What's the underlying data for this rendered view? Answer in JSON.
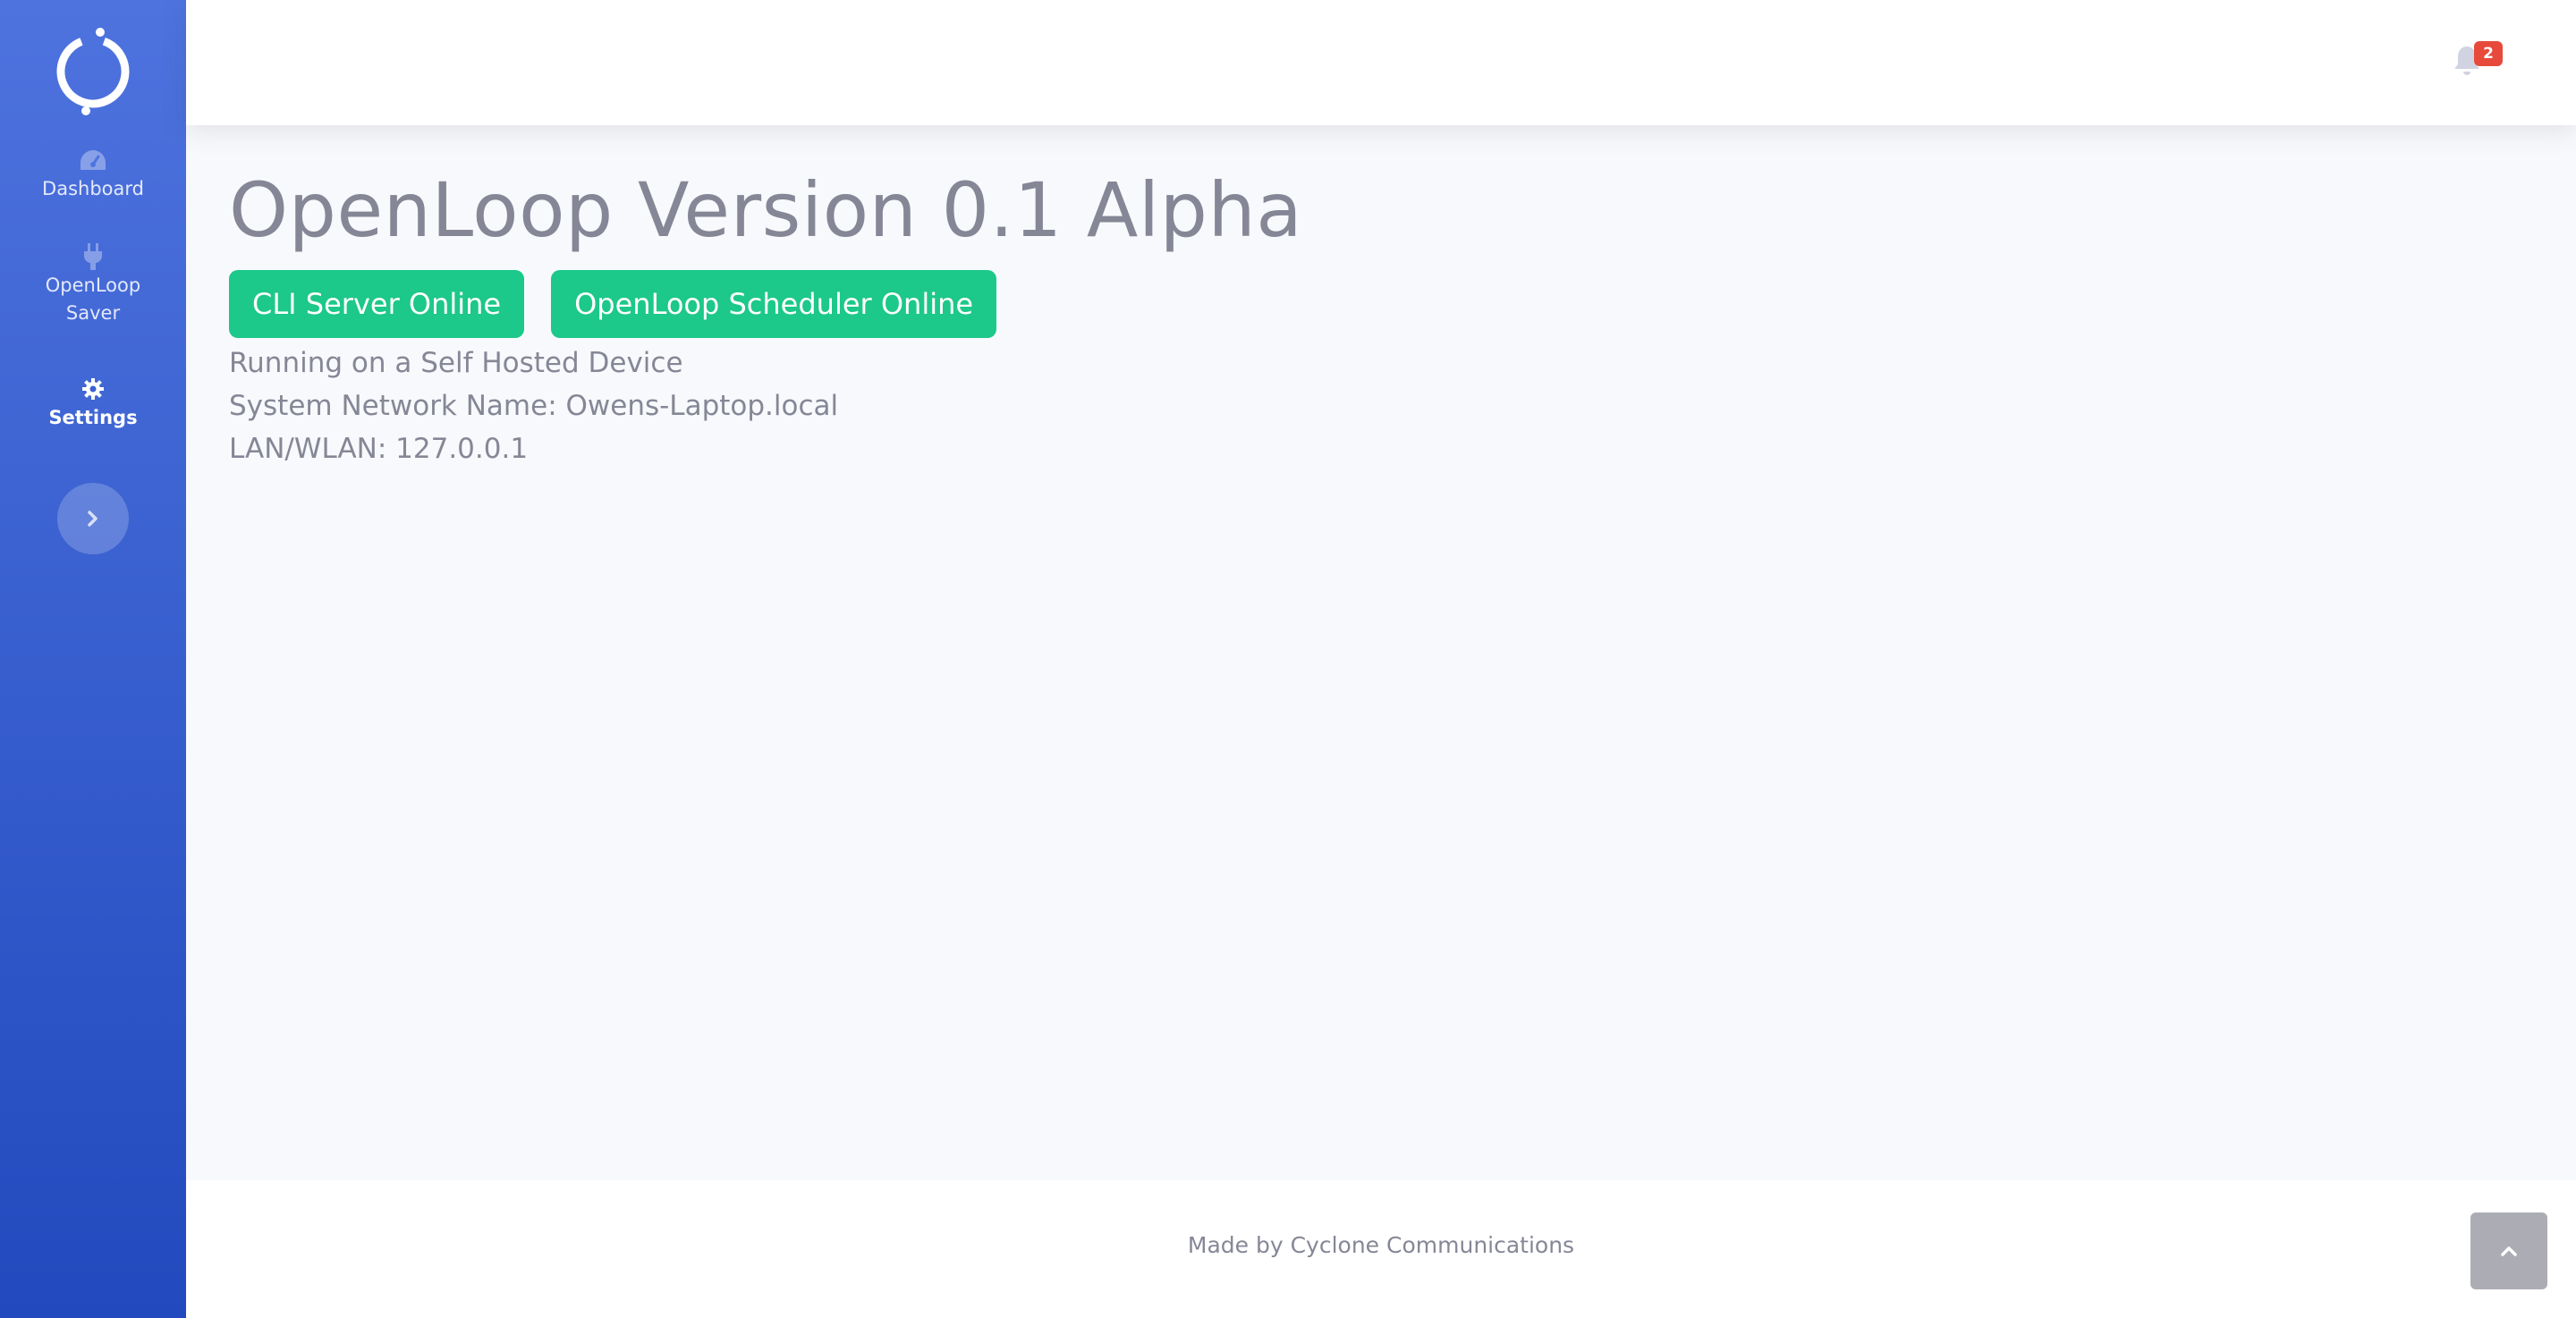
{
  "sidebar": {
    "items": [
      {
        "label": "Dashboard",
        "icon": "dashboard-icon"
      },
      {
        "label_line1": "OpenLoop",
        "label_line2": "Saver",
        "icon": "plug-icon"
      },
      {
        "label": "Settings",
        "icon": "gear-icon",
        "active": true
      }
    ],
    "toggle_icon": "chevron-right-icon"
  },
  "topbar": {
    "notification_count": "2",
    "icon": "bell-icon"
  },
  "main": {
    "title": "OpenLoop Version 0.1 Alpha",
    "status_buttons": [
      "CLI Server Online",
      "OpenLoop Scheduler Online"
    ],
    "info": [
      "Running on a Self Hosted Device",
      "System Network Name: Owens-Laptop.local",
      "LAN/WLAN: 127.0.0.1"
    ]
  },
  "footer": {
    "text": "Made by Cyclone Communications"
  },
  "colors": {
    "sidebar_top": "#4e73df",
    "sidebar_bottom": "#224abe",
    "success": "#1cc88a",
    "badge": "#e74a3b",
    "text_muted": "#858796"
  }
}
